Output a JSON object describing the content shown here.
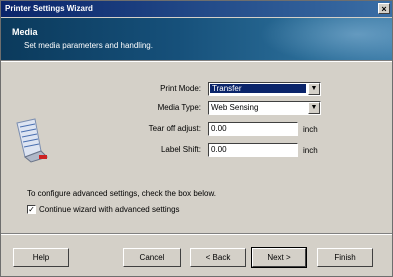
{
  "window": {
    "title": "Printer Settings Wizard",
    "close_glyph": "×"
  },
  "banner": {
    "heading": "Media",
    "subtitle": "Set media parameters and handling."
  },
  "form": {
    "print_mode": {
      "label": "Print Mode:",
      "value": "Transfer"
    },
    "media_type": {
      "label": "Media Type:",
      "value": "Web Sensing"
    },
    "tear_off": {
      "label": "Tear off adjust:",
      "value": "0.00",
      "unit": "inch"
    },
    "label_shift": {
      "label": "Label Shift:",
      "value": "0.00",
      "unit": "inch"
    }
  },
  "advanced": {
    "note": "To configure advanced settings, check the box below.",
    "checkbox_label": "Continue wizard with advanced settings",
    "checked": true
  },
  "buttons": {
    "help": "Help",
    "cancel": "Cancel",
    "back": "< Back",
    "next": "Next >",
    "finish": "Finish"
  },
  "icons": {
    "printer": "printer-icon",
    "dropdown": "chevron-down-icon",
    "check": "checkmark-icon"
  },
  "colors": {
    "title_bar": "#0a246a",
    "banner": "#16507a",
    "selection": "#0a246a",
    "face": "#d4d0c8"
  }
}
